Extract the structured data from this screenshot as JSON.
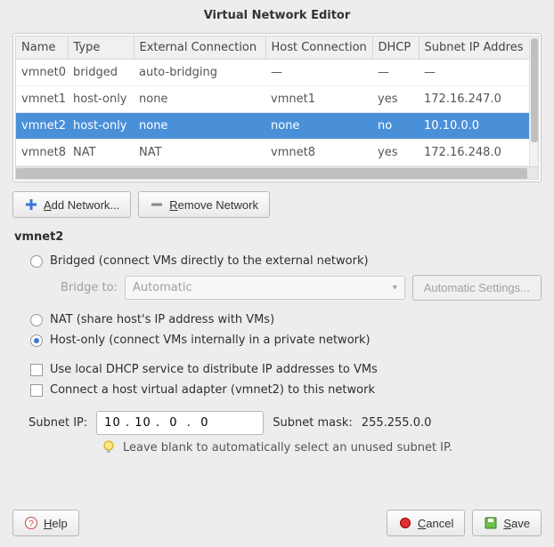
{
  "window": {
    "title": "Virtual Network Editor"
  },
  "table": {
    "headers": {
      "name": "Name",
      "type": "Type",
      "external": "External Connection",
      "host": "Host Connection",
      "dhcp": "DHCP",
      "subnet": "Subnet IP Addres"
    },
    "rows": [
      {
        "name": "vmnet0",
        "type": "bridged",
        "external": "auto-bridging",
        "host": "—",
        "dhcp": "—",
        "subnet": "—"
      },
      {
        "name": "vmnet1",
        "type": "host-only",
        "external": "none",
        "host": "vmnet1",
        "dhcp": "yes",
        "subnet": "172.16.247.0"
      },
      {
        "name": "vmnet2",
        "type": "host-only",
        "external": "none",
        "host": "none",
        "dhcp": "no",
        "subnet": "10.10.0.0"
      },
      {
        "name": "vmnet8",
        "type": "NAT",
        "external": "NAT",
        "host": "vmnet8",
        "dhcp": "yes",
        "subnet": "172.16.248.0"
      }
    ],
    "selected_index": 2
  },
  "buttons": {
    "add_pre": "A",
    "add_rest": "dd Network...",
    "remove_pre": "R",
    "remove_rest": "emove Network",
    "help_pre": "H",
    "help_rest": "elp",
    "cancel_pre": "C",
    "cancel_rest": "ancel",
    "save_pre": "S",
    "save_rest": "ave",
    "auto_settings": "Automatic Settings..."
  },
  "section": {
    "heading": "vmnet2"
  },
  "options": {
    "bridged_pre": "B",
    "bridged_rest": "ridged (connect VMs directly to the external network)",
    "bridge_to_label": "Bridge to:",
    "bridge_to_value": "Automatic",
    "nat_pre": "N",
    "nat_rest": "AT (share host's IP address with VMs)",
    "hostonly_pre": "Host-o",
    "hostonly_u": "n",
    "hostonly_rest": "ly (connect VMs internally in a private network)",
    "dhcp_pre": "Use local ",
    "dhcp_u": "D",
    "dhcp_rest": "HCP service to distribute IP addresses to VMs",
    "hostadapter_pre": "Connect a host ",
    "hostadapter_u": "v",
    "hostadapter_rest": "irtual adapter (vmnet2) to this network"
  },
  "subnet": {
    "ip_label": "Subnet IP:",
    "ip_value": "10 . 10 .  0  .  0",
    "mask_label": "Subnet mask:",
    "mask_value": "255.255.0.0",
    "hint": "Leave blank to automatically select an unused subnet IP."
  }
}
